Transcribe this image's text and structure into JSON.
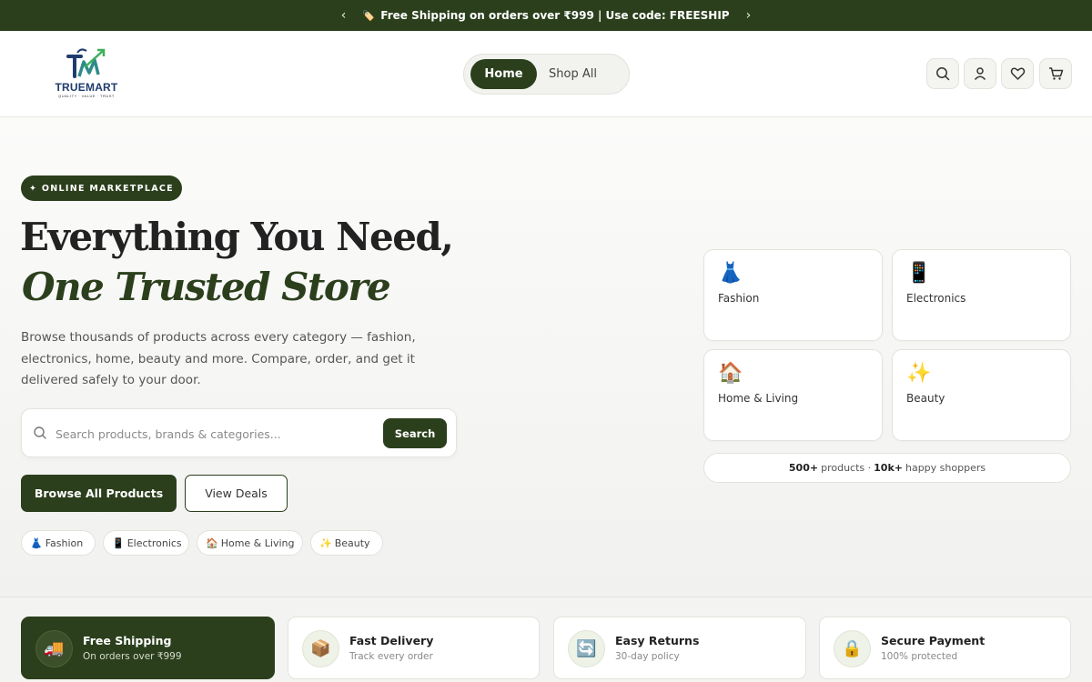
{
  "colors": {
    "brand": "#2b3f1c",
    "accent": "#2b3f1c",
    "background": "#f3f4f1"
  },
  "announcement": {
    "prev_icon": "chevron-left-icon",
    "next_icon": "chevron-right-icon",
    "prev": "‹",
    "next": "›",
    "tag": "🏷️",
    "text": "Free Shipping on orders over ₹999 | Use code: FREESHIP"
  },
  "header": {
    "logo": {
      "name": "TRUEMART",
      "tagline": "QUALITY · VALUE · TRUST"
    },
    "nav": [
      {
        "label": "Home",
        "active": true
      },
      {
        "label": "Shop All",
        "active": false
      }
    ],
    "icons": [
      "search-icon",
      "user-icon",
      "heart-icon",
      "cart-icon"
    ]
  },
  "hero": {
    "badge": "✦ ONLINE MARKETPLACE",
    "headline_line1": "Everything You Need,",
    "headline_line2": "One Trusted Store",
    "description": "Browse thousands of products across every category — fashion, electronics, home, beauty and more. Compare, order, and get it delivered safely to your door.",
    "search": {
      "placeholder": "Search products, brands & categories...",
      "value": "",
      "button": "Search"
    },
    "primary_button": "Browse All Products",
    "secondary_button": "View Deals",
    "chips": [
      {
        "emoji": "👗",
        "label": "Fashion"
      },
      {
        "emoji": "📱",
        "label": "Electronics"
      },
      {
        "emoji": "🏠",
        "label": "Home & Living"
      },
      {
        "emoji": "✨",
        "label": "Beauty"
      }
    ]
  },
  "categories": [
    {
      "emoji": "👗",
      "label": "Fashion"
    },
    {
      "emoji": "📱",
      "label": "Electronics"
    },
    {
      "emoji": "🏠",
      "label": "Home & Living"
    },
    {
      "emoji": "✨",
      "label": "Beauty"
    }
  ],
  "stats": {
    "products": "500+",
    "products_label": "products ·",
    "shoppers": "10k+",
    "shoppers_label": "happy shoppers"
  },
  "features": [
    {
      "emoji": "🚚",
      "title": "Free Shipping",
      "subtitle": "On orders over ₹999"
    },
    {
      "emoji": "📦",
      "title": "Fast Delivery",
      "subtitle": "Track every order"
    },
    {
      "emoji": "🔄",
      "title": "Easy Returns",
      "subtitle": "30-day policy"
    },
    {
      "emoji": "🔒",
      "title": "Secure Payment",
      "subtitle": "100% protected"
    }
  ]
}
